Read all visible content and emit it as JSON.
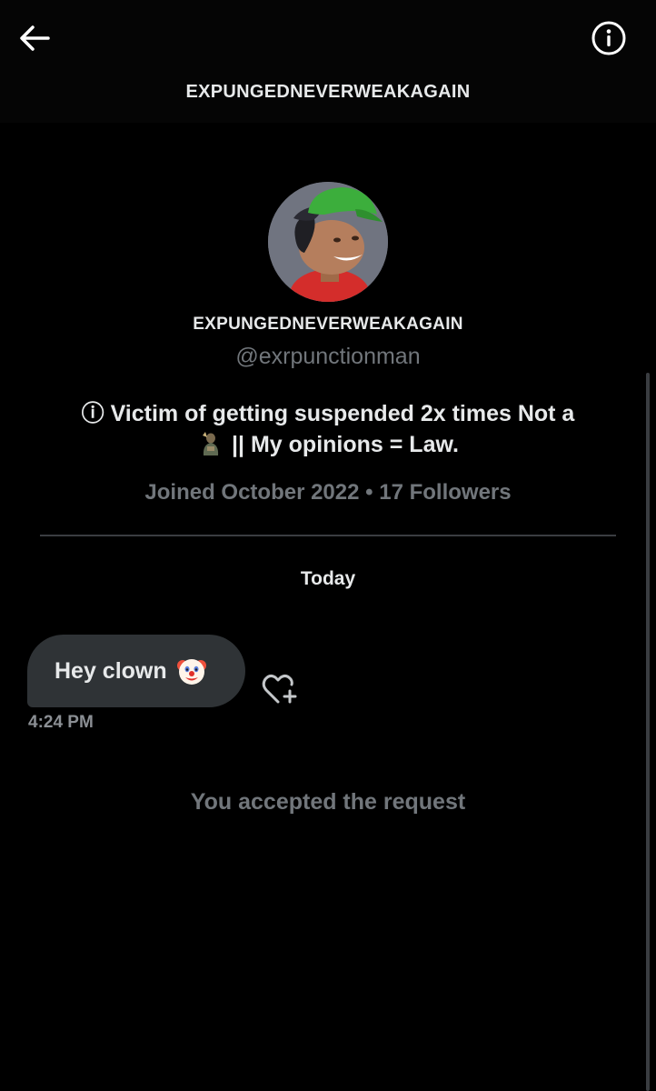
{
  "header": {
    "title": "EXPUNGEDNEVERWEAKAGAIN",
    "back_icon": "arrow-left-icon",
    "info_icon": "info-circle-icon"
  },
  "profile": {
    "avatar_icon": "avatar-image",
    "display_name": "EXPUNGEDNEVERWEAKAGAIN",
    "handle": "@exrpunctionman",
    "bio_line1": "ⓘ Victim of getting suspended 2x times  Not a",
    "bio_line2": "|| My opinions = Law.",
    "bio_emoji_icon": "figure-emoji-icon",
    "meta": "Joined October 2022 • 17 Followers"
  },
  "conversation": {
    "date_separator": "Today",
    "messages": [
      {
        "text": "Hey clown",
        "emoji_icon": "clown-face-emoji-icon",
        "time": "4:24 PM",
        "react_icon": "heart-plus-icon"
      }
    ],
    "system_message": "You accepted the request"
  },
  "colors": {
    "background": "#000000",
    "bubble": "#2f3336",
    "primary_text": "#e7e9ea",
    "secondary_text": "#71767b",
    "divider": "#3a3d41"
  }
}
